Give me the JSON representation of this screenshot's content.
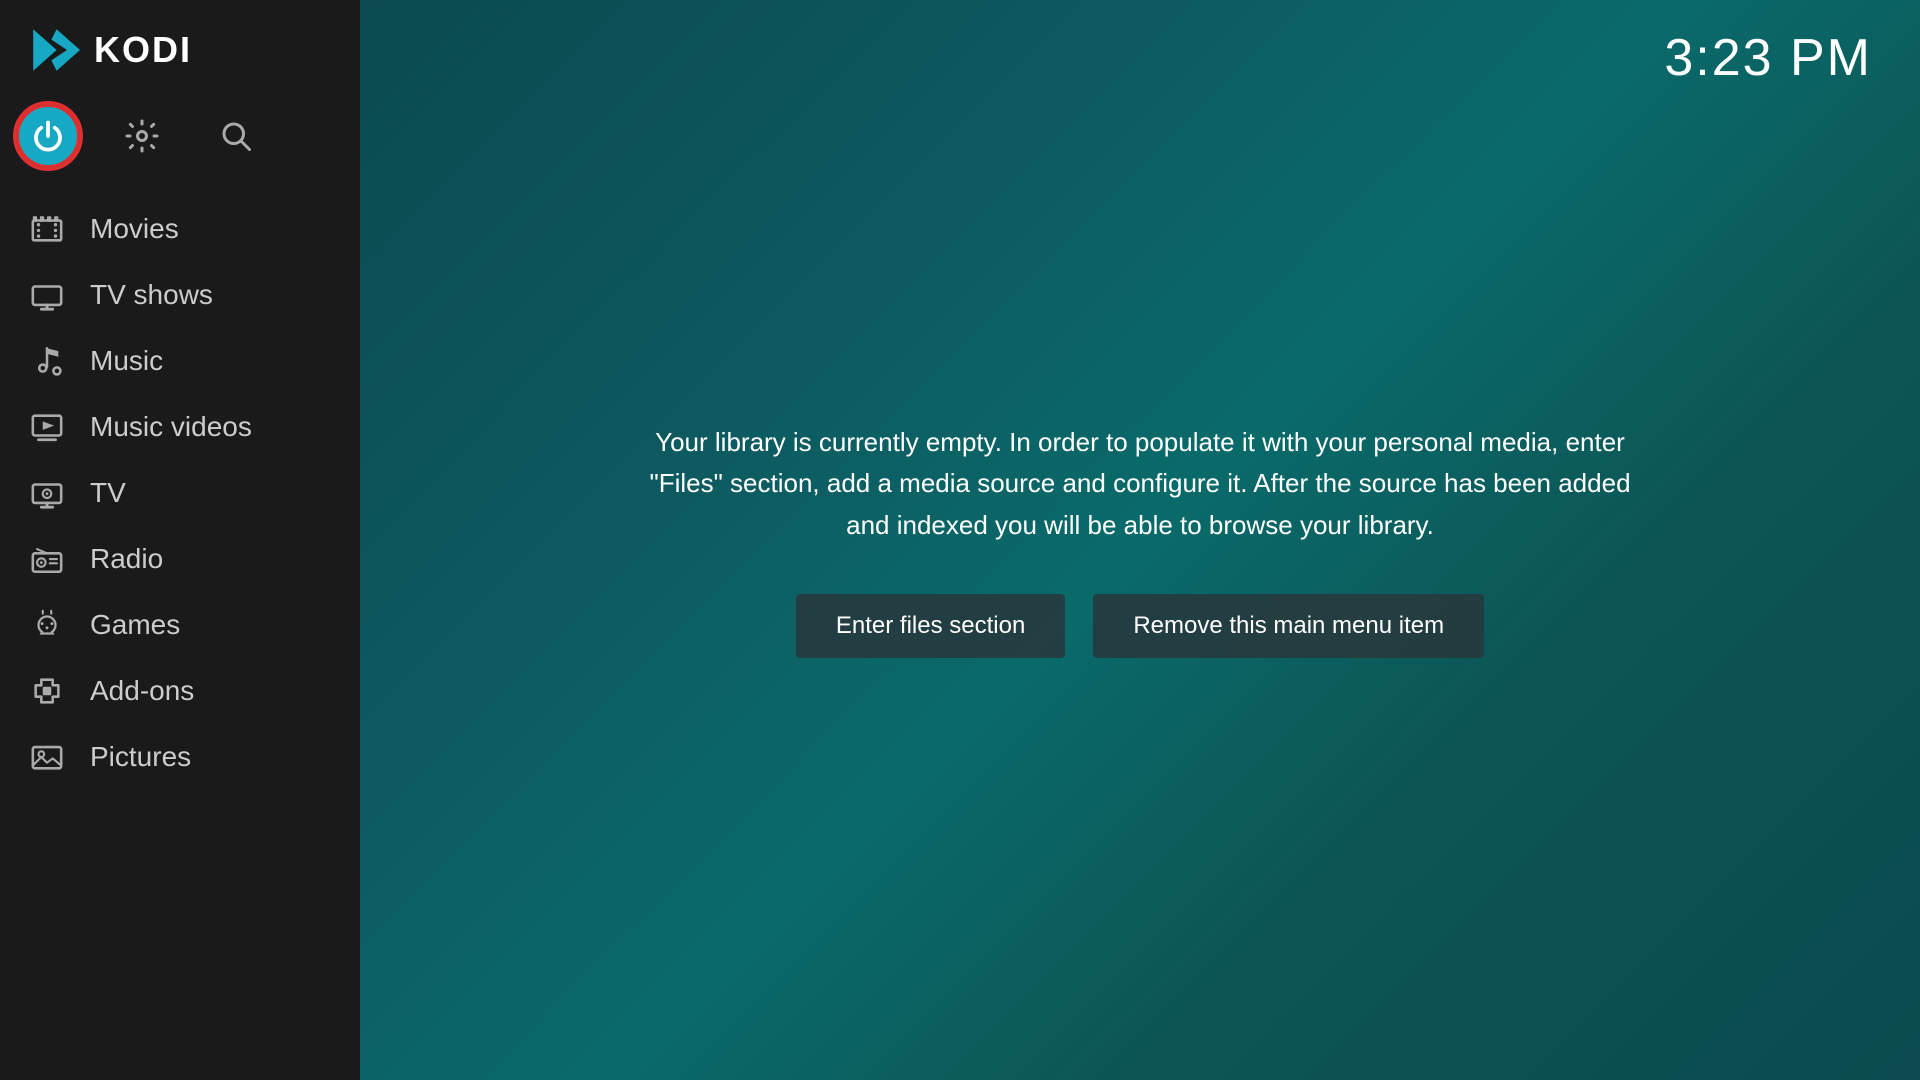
{
  "header": {
    "logo_alt": "Kodi Logo",
    "title": "KODI"
  },
  "clock": "3:23 PM",
  "top_icons": [
    {
      "name": "power",
      "label": "Power"
    },
    {
      "name": "settings",
      "label": "Settings"
    },
    {
      "name": "search",
      "label": "Search"
    }
  ],
  "nav": {
    "items": [
      {
        "id": "movies",
        "label": "Movies",
        "icon": "movies"
      },
      {
        "id": "tvshows",
        "label": "TV shows",
        "icon": "tv"
      },
      {
        "id": "music",
        "label": "Music",
        "icon": "music"
      },
      {
        "id": "musicvideos",
        "label": "Music videos",
        "icon": "musicvideos"
      },
      {
        "id": "tv",
        "label": "TV",
        "icon": "livetv"
      },
      {
        "id": "radio",
        "label": "Radio",
        "icon": "radio"
      },
      {
        "id": "games",
        "label": "Games",
        "icon": "games"
      },
      {
        "id": "addons",
        "label": "Add-ons",
        "icon": "addons"
      },
      {
        "id": "pictures",
        "label": "Pictures",
        "icon": "pictures"
      }
    ]
  },
  "main": {
    "empty_library_message": "Your library is currently empty. In order to populate it with your personal media, enter \"Files\" section, add a media source and configure it. After the source has been added and indexed you will be able to browse your library.",
    "enter_files_label": "Enter files section",
    "remove_item_label": "Remove this main menu item"
  }
}
